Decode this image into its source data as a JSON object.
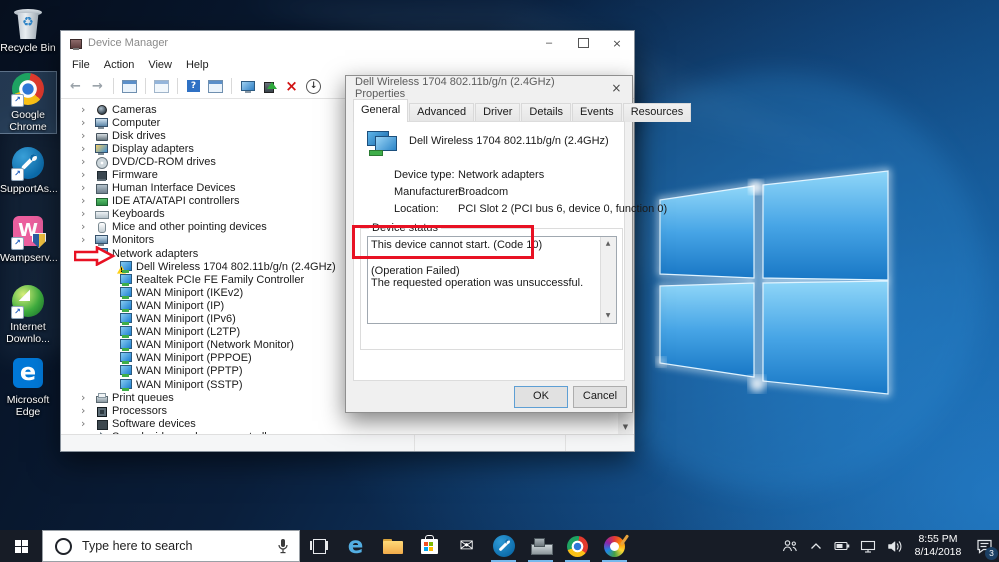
{
  "colors": {
    "annotation_red": "#e81123",
    "taskbar_underline": "#76b9ed",
    "desktop_accent_blue": "#1e7fd0"
  },
  "desktop": {
    "icons": [
      {
        "label": "Recycle Bin",
        "selected": false
      },
      {
        "label": "Google Chrome",
        "selected": true
      },
      {
        "label": "SupportAs...",
        "selected": false
      },
      {
        "label": "Wampserv...",
        "selected": false
      },
      {
        "label": "Internet Downlo...",
        "selected": false
      },
      {
        "label": "Microsoft Edge",
        "selected": false
      }
    ]
  },
  "device_manager": {
    "title": "Device Manager",
    "menu": [
      "File",
      "Action",
      "View",
      "Help"
    ],
    "toolbar_icons": [
      "back",
      "forward",
      "console-window",
      "export",
      "help",
      "properties",
      "scan-for-hardware-changes",
      "update-driver",
      "uninstall-device",
      "disable-device"
    ],
    "tree": [
      {
        "label": "Cameras",
        "icon": "camera",
        "state": "collapsed"
      },
      {
        "label": "Computer",
        "icon": "computer",
        "state": "collapsed"
      },
      {
        "label": "Disk drives",
        "icon": "disk",
        "state": "collapsed"
      },
      {
        "label": "Display adapters",
        "icon": "display-adapter",
        "state": "collapsed"
      },
      {
        "label": "DVD/CD-ROM drives",
        "icon": "dvd-drive",
        "state": "collapsed"
      },
      {
        "label": "Firmware",
        "icon": "firmware",
        "state": "collapsed"
      },
      {
        "label": "Human Interface Devices",
        "icon": "hid",
        "state": "collapsed"
      },
      {
        "label": "IDE ATA/ATAPI controllers",
        "icon": "ide-controller",
        "state": "collapsed"
      },
      {
        "label": "Keyboards",
        "icon": "keyboard",
        "state": "collapsed"
      },
      {
        "label": "Mice and other pointing devices",
        "icon": "mouse",
        "state": "collapsed"
      },
      {
        "label": "Monitors",
        "icon": "monitor",
        "state": "collapsed"
      },
      {
        "label": "Network adapters",
        "icon": "network-adapter",
        "state": "expanded",
        "children": [
          {
            "label": "Dell Wireless 1704 802.11b/g/n (2.4GHz)",
            "warning": true
          },
          {
            "label": "Realtek PCIe FE Family Controller",
            "warning": false
          },
          {
            "label": "WAN Miniport (IKEv2)",
            "warning": false
          },
          {
            "label": "WAN Miniport (IP)",
            "warning": false
          },
          {
            "label": "WAN Miniport (IPv6)",
            "warning": false
          },
          {
            "label": "WAN Miniport (L2TP)",
            "warning": false
          },
          {
            "label": "WAN Miniport (Network Monitor)",
            "warning": false
          },
          {
            "label": "WAN Miniport (PPPOE)",
            "warning": false
          },
          {
            "label": "WAN Miniport (PPTP)",
            "warning": false
          },
          {
            "label": "WAN Miniport (SSTP)",
            "warning": false
          }
        ]
      },
      {
        "label": "Print queues",
        "icon": "printer",
        "state": "collapsed"
      },
      {
        "label": "Processors",
        "icon": "processor",
        "state": "collapsed"
      },
      {
        "label": "Software devices",
        "icon": "software-device",
        "state": "collapsed"
      },
      {
        "label": "Sound, video and game controllers",
        "icon": "sound",
        "state": "collapsed"
      }
    ]
  },
  "dialog": {
    "title": "Dell Wireless 1704 802.11b/g/n (2.4GHz) Properties",
    "tabs": [
      {
        "label": "General",
        "active": true
      },
      {
        "label": "Advanced",
        "active": false
      },
      {
        "label": "Driver",
        "active": false
      },
      {
        "label": "Details",
        "active": false
      },
      {
        "label": "Events",
        "active": false
      },
      {
        "label": "Resources",
        "active": false
      }
    ],
    "device_name": "Dell Wireless 1704 802.11b/g/n (2.4GHz)",
    "fields": [
      {
        "label": "Device type:",
        "value": "Network adapters"
      },
      {
        "label": "Manufacturer:",
        "value": "Broadcom"
      },
      {
        "label": "Location:",
        "value": "PCI Slot 2 (PCI bus 6, device 0, function 0)"
      }
    ],
    "status_group_label": "Device status",
    "status_lines": [
      "This device cannot start. (Code 10)",
      "",
      "(Operation Failed)",
      "The requested operation was unsuccessful."
    ],
    "buttons": {
      "ok": "OK",
      "cancel": "Cancel"
    }
  },
  "taskbar": {
    "search_placeholder": "Type here to search",
    "pinned_apps": [
      "task-view",
      "edge",
      "file-explorer",
      "store",
      "mail",
      "supportassist",
      "device-manager",
      "chrome",
      "paint-3d"
    ],
    "running_apps": [
      "supportassist",
      "device-manager",
      "chrome",
      "paint-3d"
    ],
    "tray": {
      "time": "8:55 PM",
      "date": "8/14/2018",
      "notification_count": "3"
    }
  }
}
